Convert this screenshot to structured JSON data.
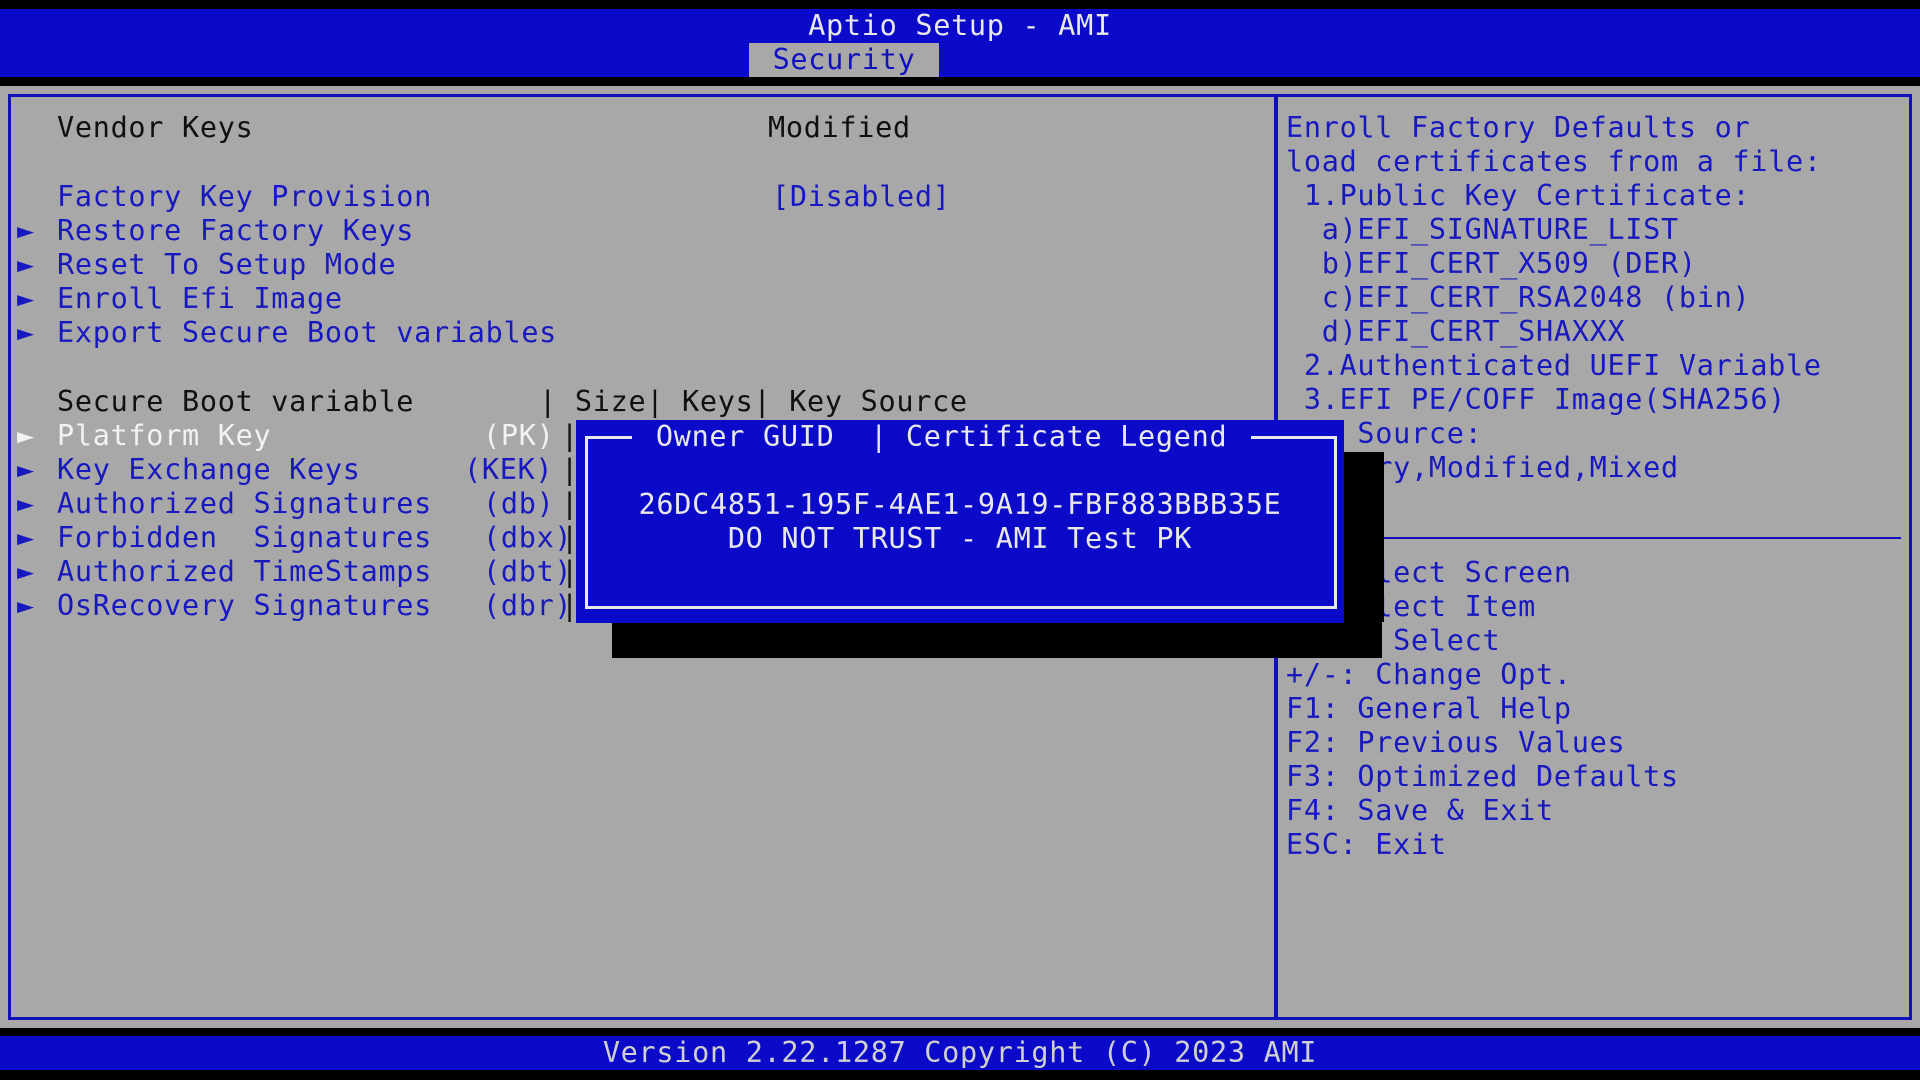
{
  "app_title": "Aptio Setup - AMI",
  "active_tab": "Security",
  "left": {
    "vendor_keys_label": "Vendor Keys",
    "vendor_keys_value": "Modified",
    "factory_key_provision_label": "Factory Key Provision",
    "factory_key_provision_value": "[Disabled]",
    "menu_items": [
      "Restore Factory Keys",
      "Reset To Setup Mode",
      "Enroll Efi Image",
      "Export Secure Boot variables"
    ],
    "table_header": "Secure Boot variable       | Size| Keys| Key Source",
    "rows": [
      {
        "name": "Platform Key",
        "abbr": "(PK)"
      },
      {
        "name": "Key Exchange Keys",
        "abbr": "(KEK)"
      },
      {
        "name": "Authorized Signatures",
        "abbr": "(db)"
      },
      {
        "name": "Forbidden  Signatures",
        "abbr": "(dbx)"
      },
      {
        "name": "Authorized TimeStamps",
        "abbr": "(dbt)"
      },
      {
        "name": "OsRecovery Signatures",
        "abbr": "(dbr)"
      }
    ]
  },
  "popup": {
    "title": " Owner GUID  | Certificate Legend ",
    "guid": "26DC4851-195F-4AE1-9A19-FBF883BBB35E",
    "legend": "DO NOT TRUST - AMI Test PK"
  },
  "help": {
    "lines": [
      "Enroll Factory Defaults or",
      "load certificates from a file:",
      " 1.Public Key Certificate:",
      "  a)EFI_SIGNATURE_LIST",
      "  b)EFI_CERT_X509 (DER)",
      "  c)EFI_CERT_RSA2048 (bin)",
      "  d)EFI_CERT_SHAXXX",
      " 2.Authenticated UEFI Variable",
      " 3.EFI PE/COFF Image(SHA256)",
      "    Source:",
      "    ory,Modified,Mixed"
    ],
    "keys": [
      "    elect Screen",
      "    elect Item",
      "    : Select",
      "+/-: Change Opt.",
      "F1: General Help",
      "F2: Previous Values",
      "F3: Optimized Defaults",
      "F4: Save & Exit",
      "ESC: Exit"
    ]
  },
  "footer": "Version 2.22.1287 Copyright (C) 2023 AMI",
  "colors": {
    "bios_blue": "#0a0ac8",
    "panel_gray": "#a8a8a8",
    "text_white": "#f2f2f2",
    "text_blue": "#1818c0"
  }
}
